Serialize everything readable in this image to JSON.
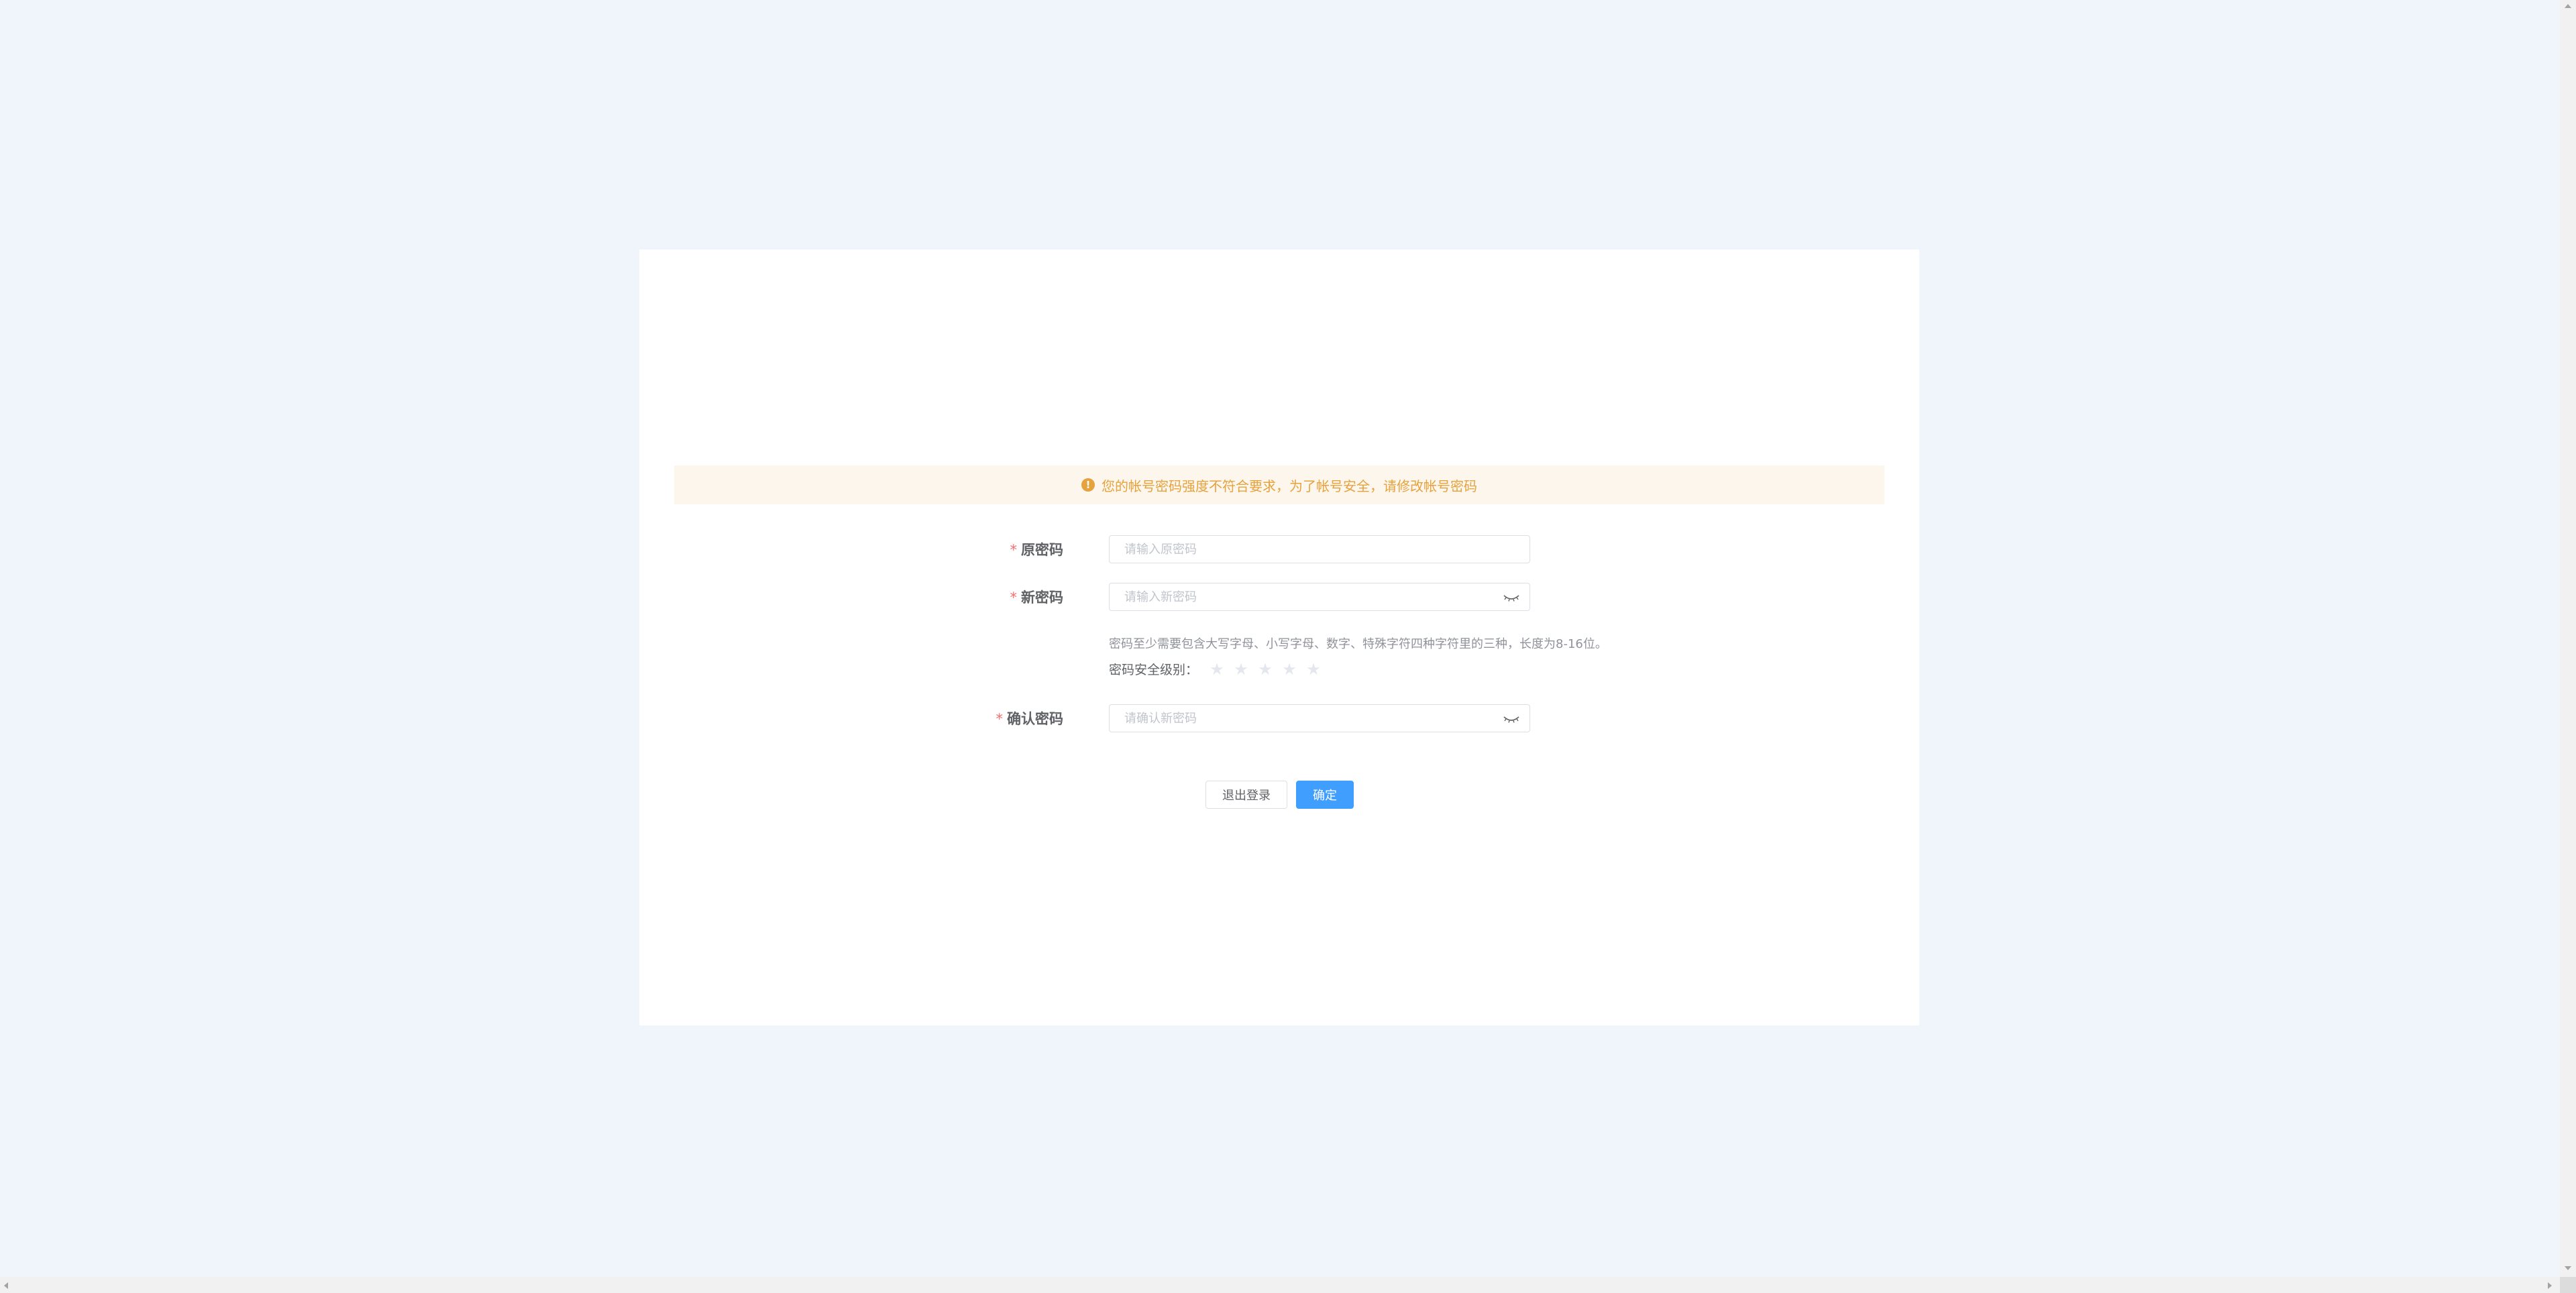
{
  "alert": {
    "icon": "warning-circle-icon",
    "icon_glyph": "!",
    "message": "您的帐号密码强度不符合要求，为了帐号安全，请修改帐号密码",
    "color": "#e6a23c",
    "background": "#fdf6ec"
  },
  "form": {
    "required_mark": "*",
    "old_password": {
      "label": "原密码",
      "placeholder": "请输入原密码",
      "value": ""
    },
    "new_password": {
      "label": "新密码",
      "placeholder": "请输入新密码",
      "value": "",
      "toggle_icon": "eye-closed-icon"
    },
    "hint": "密码至少需要包含大写字母、小写字母、数字、特殊字符四种字符里的三种，长度为8-16位。",
    "strength": {
      "label": "密码安全级别：",
      "rating": 0,
      "max": 5,
      "star_glyph": "★"
    },
    "confirm_password": {
      "label": "确认密码",
      "placeholder": "请确认新密码",
      "value": "",
      "toggle_icon": "eye-closed-icon"
    }
  },
  "buttons": {
    "logout": "退出登录",
    "confirm": "确定"
  },
  "colors": {
    "page_background": "#f0f4fb",
    "primary": "#409eff",
    "required": "#f56c6c"
  }
}
